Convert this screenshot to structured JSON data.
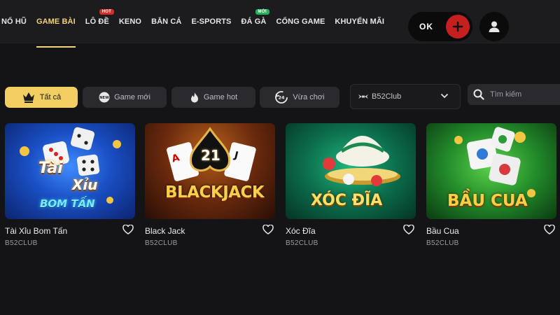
{
  "nav": {
    "items": [
      {
        "label": "NỔ HŨ"
      },
      {
        "label": "GAME BÀI",
        "active": true
      },
      {
        "label": "LÔ ĐỀ",
        "badge": "HOT"
      },
      {
        "label": "KENO"
      },
      {
        "label": "BẮN CÁ"
      },
      {
        "label": "E-SPORTS"
      },
      {
        "label": "ĐÁ GÀ",
        "badge": "MỚI"
      },
      {
        "label": "CỔNG GAME"
      },
      {
        "label": "KHUYẾN MÃI"
      }
    ]
  },
  "account": {
    "balance": "OK",
    "deposit_icon": "plus-icon",
    "user_icon": "user-icon"
  },
  "filters": {
    "chips": [
      {
        "label": "Tất cả",
        "icon": "crown-icon",
        "active": true
      },
      {
        "label": "Game mới",
        "icon": "new-icon"
      },
      {
        "label": "Game hot",
        "icon": "flame-icon"
      },
      {
        "label": "Vừa chơi",
        "icon": "recent-icon"
      }
    ],
    "provider_select": {
      "value": "B52Club"
    },
    "search": {
      "placeholder": "Tìm kiếm"
    }
  },
  "games": [
    {
      "title": "Tài Xỉu Bom Tấn",
      "provider": "B52CLUB",
      "art_text": [
        "Tài",
        "Xỉu",
        "BOM TẤN"
      ]
    },
    {
      "title": "Black Jack",
      "provider": "B52CLUB",
      "art_text": [
        "21",
        "BLACKJACK"
      ]
    },
    {
      "title": "Xóc Đĩa",
      "provider": "B52CLUB",
      "art_text": [
        "XÓC ĐĨA"
      ]
    },
    {
      "title": "Bầu Cua",
      "provider": "B52CLUB",
      "art_text": [
        "BẦU CUA"
      ]
    }
  ],
  "colors": {
    "accent": "#f2cd62",
    "background": "#141416",
    "hot_badge": "#d62b2b",
    "new_badge": "#23b15a",
    "deposit": "#c61f1f"
  }
}
